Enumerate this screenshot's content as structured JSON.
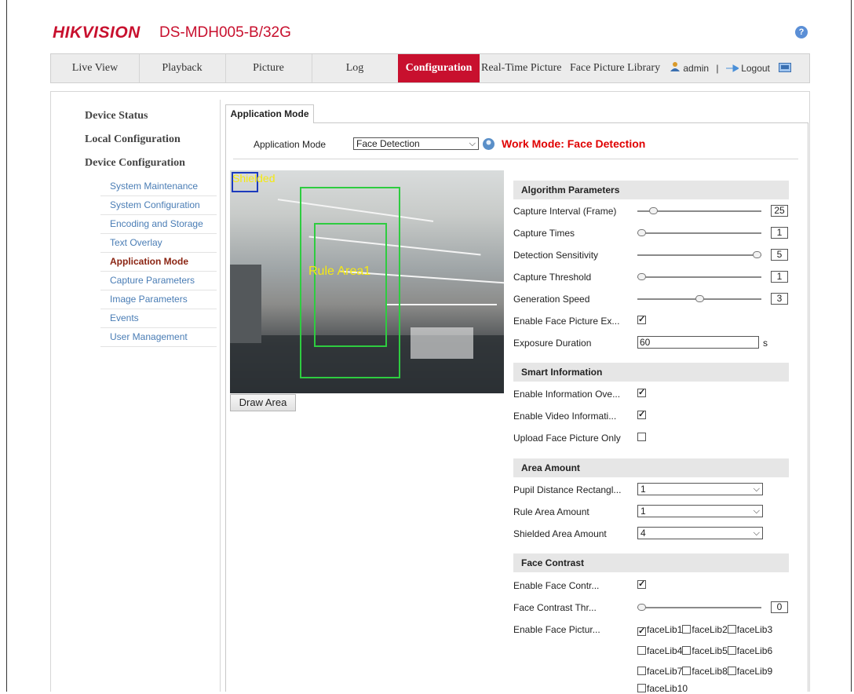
{
  "header": {
    "brand": "HIKVISION",
    "model": "DS-MDH005-B/32G",
    "help_icon": "?"
  },
  "nav": {
    "tabs": [
      {
        "label": "Live View"
      },
      {
        "label": "Playback"
      },
      {
        "label": "Picture"
      },
      {
        "label": "Log"
      },
      {
        "label": "Configuration",
        "active": true
      },
      {
        "label": "Real-Time Picture"
      },
      {
        "label": "Face Picture Library"
      }
    ],
    "user": "admin",
    "separator": "|",
    "logout": "Logout"
  },
  "sidebar": {
    "heads": [
      "Device Status",
      "Local Configuration",
      "Device Configuration"
    ],
    "items": [
      {
        "label": "System Maintenance"
      },
      {
        "label": "System Configuration"
      },
      {
        "label": "Encoding and Storage"
      },
      {
        "label": "Text Overlay"
      },
      {
        "label": "Application Mode",
        "active": true
      },
      {
        "label": "Capture Parameters"
      },
      {
        "label": "Image Parameters"
      },
      {
        "label": "Events"
      },
      {
        "label": "User Management"
      }
    ]
  },
  "content": {
    "tab": "Application Mode",
    "mode_label": "Application Mode",
    "mode_value": "Face Detection",
    "work_mode": "Work Mode: Face Detection",
    "video_labels": {
      "rule": "Rule Area1",
      "shielded": "Shielded"
    },
    "draw_button": "Draw Area"
  },
  "algorithm": {
    "title": "Algorithm Parameters",
    "capture_interval": {
      "label": "Capture Interval (Frame)",
      "value": "25",
      "level": 0.1
    },
    "capture_times": {
      "label": "Capture Times",
      "value": "1",
      "level": 0.0
    },
    "detection_sensitivity": {
      "label": "Detection Sensitivity",
      "value": "5",
      "level": 1.0
    },
    "capture_threshold": {
      "label": "Capture Threshold",
      "value": "1",
      "level": 0.0
    },
    "generation_speed": {
      "label": "Generation Speed",
      "value": "3",
      "level": 0.5
    },
    "enable_face_exposure": {
      "label": "Enable Face Picture Ex...",
      "checked": true
    },
    "exposure_duration": {
      "label": "Exposure Duration",
      "value": "60",
      "unit": "s"
    }
  },
  "smart": {
    "title": "Smart Information",
    "info_overlay": {
      "label": "Enable Information Ove...",
      "checked": true
    },
    "video_info": {
      "label": "Enable Video Informati...",
      "checked": true
    },
    "upload_face_only": {
      "label": "Upload Face Picture Only",
      "checked": false
    }
  },
  "area": {
    "title": "Area Amount",
    "pupil": {
      "label": "Pupil Distance Rectangl...",
      "value": "1"
    },
    "rule": {
      "label": "Rule Area Amount",
      "value": "1"
    },
    "shielded": {
      "label": "Shielded Area Amount",
      "value": "4"
    }
  },
  "contrast": {
    "title": "Face Contrast",
    "enable": {
      "label": "Enable Face Contr...",
      "checked": true
    },
    "threshold": {
      "label": "Face Contrast Thr...",
      "value": "0",
      "level": 0.0
    },
    "libraries_label": "Enable Face Pictur...",
    "libraries": [
      {
        "name": "faceLib1",
        "checked": true
      },
      {
        "name": "faceLib2",
        "checked": false
      },
      {
        "name": "faceLib3",
        "checked": false
      },
      {
        "name": "faceLib4",
        "checked": false
      },
      {
        "name": "faceLib5",
        "checked": false
      },
      {
        "name": "faceLib6",
        "checked": false
      },
      {
        "name": "faceLib7",
        "checked": false
      },
      {
        "name": "faceLib8",
        "checked": false
      },
      {
        "name": "faceLib9",
        "checked": false
      },
      {
        "name": "faceLib10",
        "checked": false
      }
    ]
  },
  "icons": {
    "checkmark": "✓",
    "dropdown": "⌵"
  }
}
